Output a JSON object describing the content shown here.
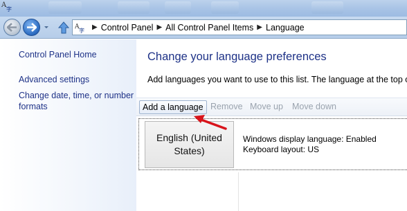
{
  "window": {
    "title_icon": "language-icon"
  },
  "navigation": {
    "back_icon": "back-arrow-icon",
    "forward_icon": "forward-arrow-icon",
    "dropdown_icon": "chevron-down-icon",
    "up_icon": "up-arrow-icon",
    "address_icon": "language-icon",
    "breadcrumbs": [
      "Control Panel",
      "All Control Panel Items",
      "Language"
    ]
  },
  "sidebar": {
    "items": [
      {
        "label": "Control Panel Home"
      },
      {
        "label": "Advanced settings"
      },
      {
        "label": "Change date, time, or number"
      },
      {
        "label": "formats"
      }
    ]
  },
  "main": {
    "title": "Change your language preferences",
    "description": "Add languages you want to use to this list. The language at the top of y",
    "toolbar": {
      "add": "Add a language",
      "remove": "Remove",
      "move_up": "Move up",
      "move_down": "Move down"
    },
    "languages": [
      {
        "name_line1": "English (United",
        "name_line2": "States)",
        "display_language": "Windows display language: Enabled",
        "keyboard_layout": "Keyboard layout: US"
      }
    ]
  },
  "colors": {
    "link": "#1e3287",
    "disabled": "#9aa3ae",
    "annotation_arrow": "#d8141b"
  }
}
